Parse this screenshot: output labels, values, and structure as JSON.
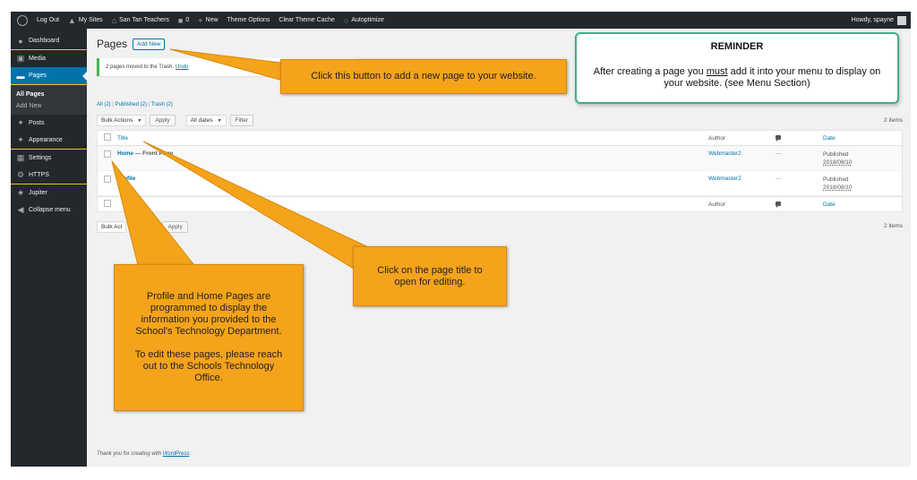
{
  "adminbar": {
    "items": [
      "Log Out",
      "My Sites",
      "San Tan Teachers",
      "0",
      "New",
      "Theme Options",
      "Clear Theme Cache",
      "Autoptimize"
    ],
    "howdy": "Howdy, spayne"
  },
  "sidebar": {
    "items": [
      {
        "label": "Dashboard",
        "icon": "dashboard-icon"
      },
      {
        "label": "Media",
        "icon": "media-icon"
      },
      {
        "label": "Pages",
        "icon": "pages-icon"
      },
      {
        "label": "Posts",
        "icon": "posts-icon"
      },
      {
        "label": "Appearance",
        "icon": "appearance-icon"
      },
      {
        "label": "Settings",
        "icon": "settings-icon"
      },
      {
        "label": "HTTPS",
        "icon": "gear-icon"
      },
      {
        "label": "Jupiter",
        "icon": "star-icon"
      },
      {
        "label": "Collapse menu",
        "icon": "collapse-icon"
      }
    ],
    "submenu": [
      "All Pages",
      "Add New"
    ]
  },
  "main": {
    "title": "Pages",
    "add_new": "Add New",
    "notice": "2 pages moved to the Trash.",
    "undo": "Undo",
    "filters": {
      "all": "All",
      "all_count": "(2)",
      "published": "Published",
      "published_count": "(2)",
      "trash": "Trash",
      "trash_count": "(2)",
      "sep": "|"
    },
    "bulk_actions": "Bulk Actions",
    "apply": "Apply",
    "all_dates": "All dates",
    "filter": "Filter",
    "items_count": "2 items",
    "bottom_bulk": "Bulk Act",
    "columns": {
      "title": "Title",
      "author": "Author",
      "date": "Date"
    },
    "rows": [
      {
        "title": "Home",
        "state": "— Front Page",
        "author": "Webmaster2",
        "comments": "—",
        "status": "Published",
        "date": "2018/08/10"
      },
      {
        "title": "Profile",
        "state": "",
        "author": "Webmaster2",
        "comments": "—",
        "status": "Published",
        "date": "2018/08/10"
      }
    ],
    "footer_text": "Thank you for creating with",
    "footer_link": "WordPress",
    "footer_end": "."
  },
  "callouts": {
    "add_new": "Click this button to add a new page to your website.",
    "title": "Click on the page title to open for editing.",
    "profile_home_1": "Profile and Home Pages are programmed to display the information you provided to the School's Technology Department.",
    "profile_home_2": "To edit these pages, please reach out to the Schools Technology Office.",
    "reminder_title": "REMINDER",
    "reminder_before": "After creating a page you",
    "reminder_must": "must",
    "reminder_after": "add it into your menu to display on your website. (see Menu Section)"
  },
  "colors": {
    "callout": "#f5a31a",
    "reminder_border": "#3bb08f",
    "admin_bar": "#23282d",
    "accent": "#0073aa"
  }
}
